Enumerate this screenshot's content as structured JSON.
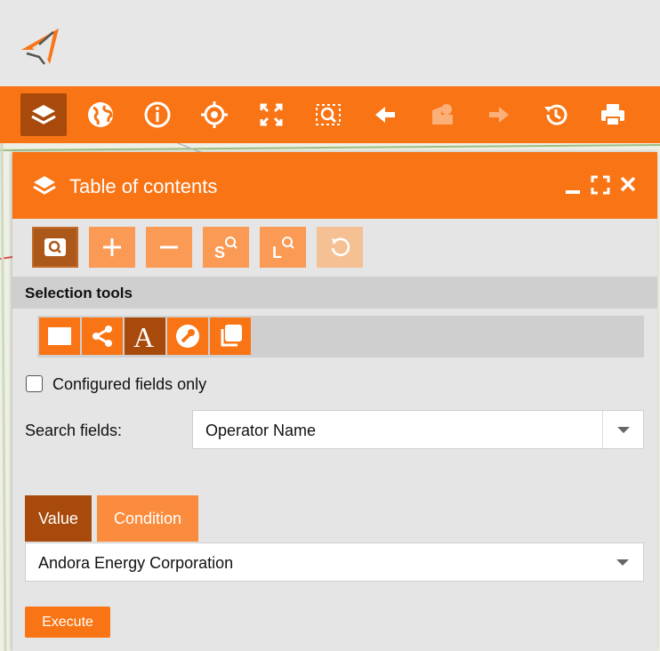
{
  "colors": {
    "accent": "#f97414",
    "accent_dark": "#a84a0b",
    "accent_light": "#fa9a55"
  },
  "toolbar": {
    "icons": [
      "layers-icon",
      "globe-icon",
      "info-icon",
      "crosshair-icon",
      "fullscreen-icon",
      "zoom-selection-icon",
      "back-arrow-icon",
      "shapes-icon",
      "forward-arrow-icon",
      "history-icon",
      "print-icon"
    ]
  },
  "panel": {
    "title": "Table of contents",
    "tools": [
      "zoom-search-icon",
      "plus-icon",
      "minus-icon",
      "search-s-icon",
      "search-l-icon",
      "reset-icon"
    ],
    "section_title": "Selection tools",
    "selection_tools": [
      "rectangle-select-icon",
      "share-nodes-icon",
      "text-a-icon",
      "wrench-icon",
      "copy-layers-icon"
    ],
    "configured_fields_label": "Configured fields only",
    "configured_fields_checked": false,
    "search_fields_label": "Search fields:",
    "search_fields_value": "Operator Name",
    "tabs": {
      "value": "Value",
      "condition": "Condition"
    },
    "value_selected": "Andora Energy Corporation",
    "execute_label": "Execute"
  }
}
